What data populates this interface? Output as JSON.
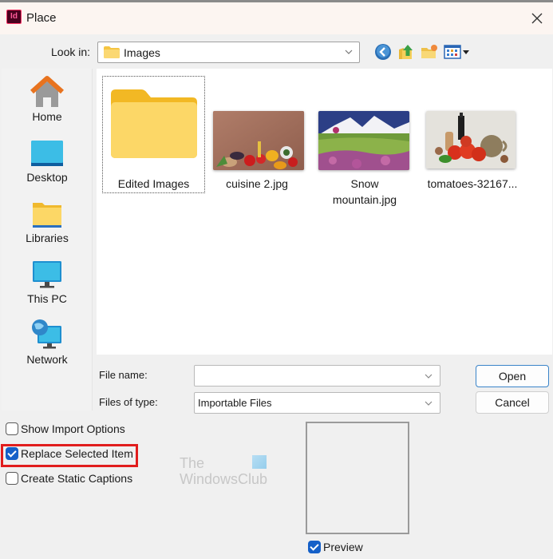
{
  "dialog": {
    "app_icon_text": "Id",
    "title": "Place",
    "close_icon": "close-icon"
  },
  "look_in": {
    "label": "Look in:",
    "value": "Images",
    "folder_icon": "folder-icon"
  },
  "toolbar": {
    "buttons": [
      {
        "name": "back",
        "icon": "back-arrow-icon"
      },
      {
        "name": "up-one-level",
        "icon": "up-folder-icon"
      },
      {
        "name": "new-folder",
        "icon": "new-folder-icon"
      },
      {
        "name": "view-menu",
        "icon": "view-grid-icon"
      }
    ]
  },
  "places": [
    {
      "label": "Home",
      "icon": "home-icon"
    },
    {
      "label": "Desktop",
      "icon": "desktop-icon"
    },
    {
      "label": "Libraries",
      "icon": "libraries-icon"
    },
    {
      "label": "This PC",
      "icon": "computer-icon"
    },
    {
      "label": "Network",
      "icon": "network-icon"
    }
  ],
  "files": [
    {
      "name": "Edited Images",
      "type": "folder",
      "selected": true
    },
    {
      "name": "cuisine 2.jpg",
      "type": "image"
    },
    {
      "name_line1": "Snow",
      "name_line2": "mountain.jpg",
      "name": "Snow mountain.jpg",
      "type": "image"
    },
    {
      "name": "tomatoes-32167...",
      "type": "image"
    }
  ],
  "file_name": {
    "label": "File name:",
    "value": "",
    "placeholder": ""
  },
  "files_of_type": {
    "label": "Files of type:",
    "value": "Importable Files"
  },
  "buttons": {
    "open": "Open",
    "cancel": "Cancel"
  },
  "options": [
    {
      "label": "Show Import Options",
      "checked": false
    },
    {
      "label": "Replace Selected Item",
      "checked": true,
      "highlighted": true
    },
    {
      "label": "Create Static Captions",
      "checked": false
    }
  ],
  "preview": {
    "label": "Preview",
    "checked": true
  },
  "watermark": {
    "line1": "The",
    "line2": "WindowsClub"
  },
  "colors": {
    "accent": "#1560c8",
    "highlight_border": "#e11d1d",
    "open_button_border": "#3a84c9"
  }
}
